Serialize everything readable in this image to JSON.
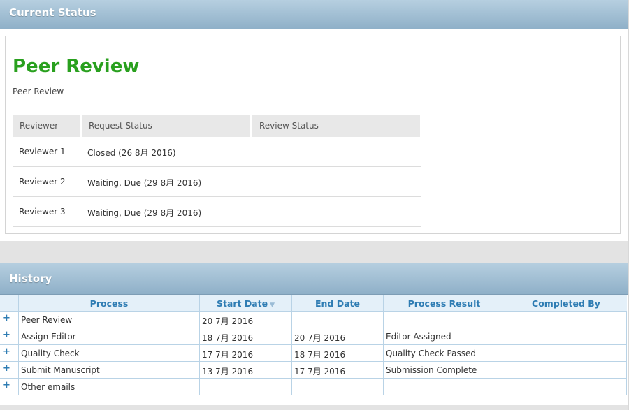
{
  "current": {
    "header": "Current Status",
    "title": "Peer Review",
    "subtitle": "Peer Review",
    "columns": [
      "Reviewer",
      "Request Status",
      "Review Status"
    ],
    "reviewers": [
      {
        "name": "Reviewer 1",
        "request_status": "Closed (26 8月 2016)",
        "review_status": ""
      },
      {
        "name": "Reviewer 2",
        "request_status": "Waiting, Due (29 8月 2016)",
        "review_status": ""
      },
      {
        "name": "Reviewer 3",
        "request_status": "Waiting, Due (29 8月 2016)",
        "review_status": ""
      }
    ]
  },
  "history": {
    "header": "History",
    "columns": [
      "Process",
      "Start Date",
      "End Date",
      "Process Result",
      "Completed By"
    ],
    "sort_icon": "sort-arrow-icon",
    "expand_symbol": "+",
    "rows": [
      {
        "process": "Peer Review",
        "start": "20 7月 2016",
        "end": "",
        "result": "",
        "by": ""
      },
      {
        "process": "Assign Editor",
        "start": "18 7月 2016",
        "end": "20 7月 2016",
        "result": "Editor Assigned",
        "by": ""
      },
      {
        "process": "Quality Check",
        "start": "17 7月 2016",
        "end": "18 7月 2016",
        "result": "Quality Check Passed",
        "by": ""
      },
      {
        "process": "Submit Manuscript",
        "start": "13 7月 2016",
        "end": "17 7月 2016",
        "result": "Submission Complete",
        "by": ""
      },
      {
        "process": "Other emails",
        "start": "",
        "end": "",
        "result": "",
        "by": ""
      }
    ]
  },
  "colors": {
    "title_green": "#29a01e",
    "header_blue": "#8fb0c8",
    "link_blue": "#2e7cb3"
  }
}
